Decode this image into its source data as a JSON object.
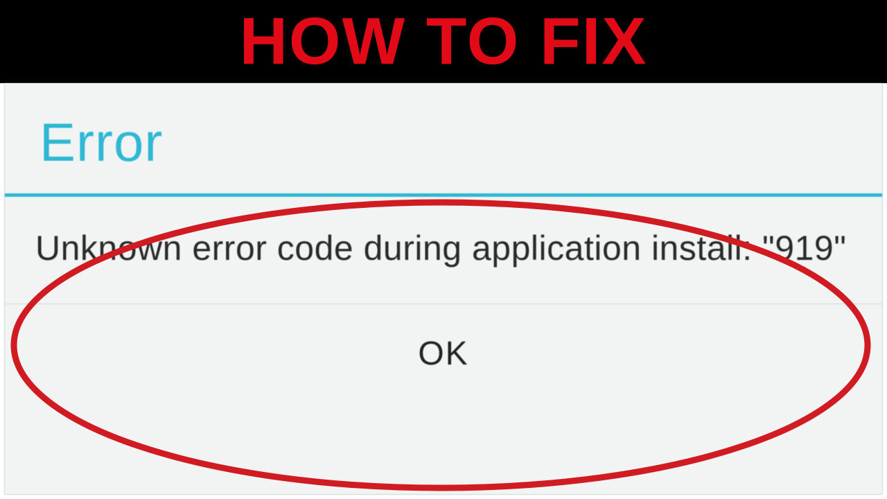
{
  "banner": {
    "headline": "HOW TO FIX"
  },
  "dialog": {
    "title": "Error",
    "message": "Unknown error code during application install: \"919\"",
    "ok_label": "OK"
  },
  "colors": {
    "accent_red": "#e20a17",
    "title_cyan": "#2fb8d4",
    "highlight_red": "#d11b22"
  }
}
